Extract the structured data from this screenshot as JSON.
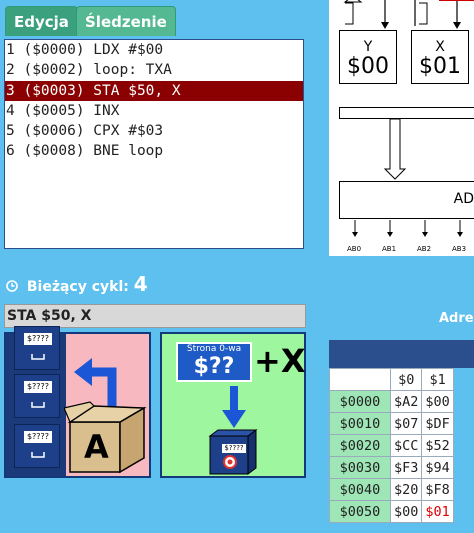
{
  "tabs": [
    {
      "label": "Edycja",
      "active": true
    },
    {
      "label": "Śledzenie",
      "active": false
    }
  ],
  "code_lines": [
    "1 ($0000) LDX #$00",
    "2 ($0002) loop: TXA",
    "3 ($0003) STA $50, X",
    "4 ($0005) INX",
    "5 ($0006) CPX #$03",
    "6 ($0008) BNE loop"
  ],
  "highlighted_line_index": 2,
  "cycle": {
    "label": "Bieżący cykl:",
    "value": "4"
  },
  "current_instruction": "STA $50, X",
  "panel_a": {
    "drawer_labels": [
      "$????",
      "$????",
      "$????"
    ],
    "box_letter": "A"
  },
  "panel_b": {
    "page_label": "Strona 0-wa",
    "page_value": "$??",
    "offset_label": "+X",
    "target_label": "$????"
  },
  "diagram": {
    "registers": [
      {
        "name": "Y",
        "value": "$00"
      },
      {
        "name": "X",
        "value": "$01"
      }
    ],
    "alu_label": "AD",
    "bus_labels": [
      "AB0",
      "AB1",
      "AB2",
      "AB3"
    ]
  },
  "memory": {
    "title": "Adres",
    "columns": [
      "$0",
      "$1"
    ],
    "rows": [
      {
        "addr": "$0000",
        "cells": [
          "$A2",
          "$00"
        ]
      },
      {
        "addr": "$0010",
        "cells": [
          "$07",
          "$DF"
        ]
      },
      {
        "addr": "$0020",
        "cells": [
          "$CC",
          "$52"
        ]
      },
      {
        "addr": "$0030",
        "cells": [
          "$F3",
          "$94"
        ]
      },
      {
        "addr": "$0040",
        "cells": [
          "$20",
          "$F8"
        ]
      },
      {
        "addr": "$0050",
        "cells": [
          "$00",
          "$01"
        ]
      }
    ],
    "highlight_color": "#e00000"
  },
  "colors": {
    "background": "#5ec0ee",
    "highlight_line": "#8b0000",
    "tab": "#3aa07e",
    "panel_a_bg": "#f8b8c0",
    "panel_b_bg": "#9ef79e"
  }
}
